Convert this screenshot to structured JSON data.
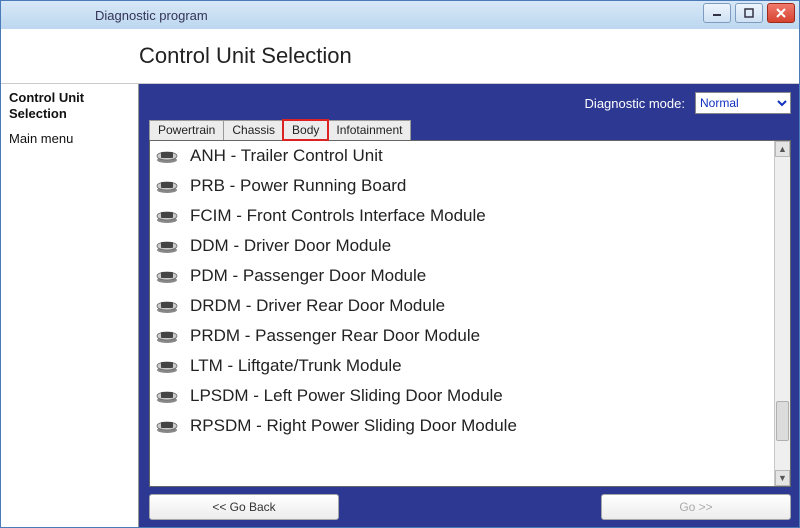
{
  "window": {
    "title": "Diagnostic program"
  },
  "banner": {
    "heading": "Control Unit Selection"
  },
  "sidebar": {
    "title_line1": "Control Unit",
    "title_line2": "Selection",
    "main_menu": "Main menu"
  },
  "diagnostic": {
    "label": "Diagnostic mode:",
    "value": "Normal"
  },
  "tabs": [
    {
      "label": "Powertrain",
      "active": false
    },
    {
      "label": "Chassis",
      "active": false
    },
    {
      "label": "Body",
      "active": true
    },
    {
      "label": "Infotainment",
      "active": false
    }
  ],
  "modules": [
    "ANH - Trailer Control Unit",
    "PRB - Power Running Board",
    "FCIM - Front Controls Interface Module",
    "DDM - Driver Door Module",
    "PDM - Passenger Door Module",
    "DRDM - Driver Rear Door Module",
    "PRDM - Passenger Rear Door Module",
    "LTM - Liftgate/Trunk Module",
    "LPSDM - Left Power Sliding Door Module",
    "RPSDM - Right Power Sliding Door Module"
  ],
  "nav": {
    "back": "<< Go Back",
    "next": "Go >>"
  }
}
